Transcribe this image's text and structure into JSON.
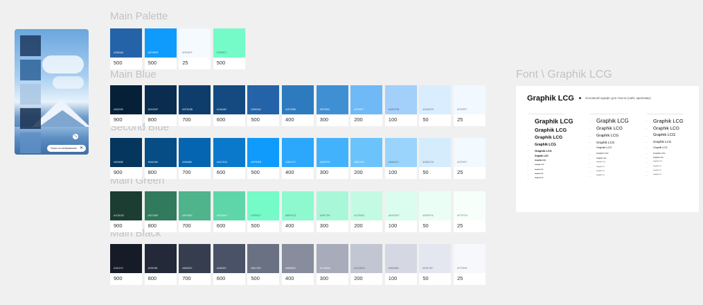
{
  "preview": {
    "tones": [
      "#1E3A5F",
      "#2F6399",
      "#A9C6E3",
      "#1B3354",
      "#5F8FC4"
    ],
    "chip_label": "Поиск по изображению",
    "chip_close": "✕",
    "cursor_icon": "expand-icon"
  },
  "sections": {
    "main_palette": "Main Palette",
    "main_blue": "Main Blue",
    "second_blue": "Second Blue",
    "main_green": "Main Green",
    "main_black": "Main Black",
    "font": "Font \\ Graphik LCG"
  },
  "palettes": {
    "main_palette": [
      {
        "color": "#2563A8",
        "shade": "500"
      },
      {
        "color": "#0F9BFB",
        "shade": "500"
      },
      {
        "color": "#F5FAFF",
        "shade": "25"
      },
      {
        "color": "#75FBC7",
        "shade": "500"
      }
    ],
    "main_blue": [
      {
        "color": "#062038",
        "shade": "900"
      },
      {
        "color": "#0A2D4F",
        "shade": "800"
      },
      {
        "color": "#0F3D6B",
        "shade": "700"
      },
      {
        "color": "#154A80",
        "shade": "600"
      },
      {
        "color": "#2563A8",
        "shade": "500"
      },
      {
        "color": "#2D7BBE",
        "shade": "400"
      },
      {
        "color": "#3F90D3",
        "shade": "300"
      },
      {
        "color": "#6FB9F7",
        "shade": "200"
      },
      {
        "color": "#A3CFFB",
        "shade": "100"
      },
      {
        "color": "#DAEDFE",
        "shade": "50"
      },
      {
        "color": "#F2F8FF",
        "shade": "25"
      }
    ],
    "second_blue": [
      {
        "color": "#05365E",
        "shade": "900"
      },
      {
        "color": "#064D85",
        "shade": "800"
      },
      {
        "color": "#0665B0",
        "shade": "700"
      },
      {
        "color": "#0A79CB",
        "shade": "600"
      },
      {
        "color": "#0F9BFB",
        "shade": "500"
      },
      {
        "color": "#2BA7FC",
        "shade": "400"
      },
      {
        "color": "#43B2FD",
        "shade": "300"
      },
      {
        "color": "#6BC3FC",
        "shade": "200"
      },
      {
        "color": "#9AD4FC",
        "shade": "100"
      },
      {
        "color": "#D5ECFD",
        "shade": "50"
      },
      {
        "color": "#F2F9FF",
        "shade": "25"
      }
    ],
    "main_green": [
      {
        "color": "#1C3D32",
        "shade": "900"
      },
      {
        "color": "#317A5D",
        "shade": "800"
      },
      {
        "color": "#4FB38C",
        "shade": "700"
      },
      {
        "color": "#5FD6A9",
        "shade": "600"
      },
      {
        "color": "#75FBC7",
        "shade": "500"
      },
      {
        "color": "#8EF9CE",
        "shade": "400"
      },
      {
        "color": "#A8F7D9",
        "shade": "300"
      },
      {
        "color": "#C2FAE4",
        "shade": "200"
      },
      {
        "color": "#DAFDEF",
        "shade": "100"
      },
      {
        "color": "#EBFEF6",
        "shade": "50"
      },
      {
        "color": "#F7FFFB",
        "shade": "25"
      }
    ],
    "main_black": [
      {
        "color": "#161C27",
        "shade": "900"
      },
      {
        "color": "#232938",
        "shade": "800"
      },
      {
        "color": "#363D4F",
        "shade": "700"
      },
      {
        "color": "#4A5267",
        "shade": "600"
      },
      {
        "color": "#6A7183",
        "shade": "500"
      },
      {
        "color": "#888D9D",
        "shade": "400"
      },
      {
        "color": "#A7ABBA",
        "shade": "300"
      },
      {
        "color": "#C2C6D3",
        "shade": "200"
      },
      {
        "color": "#D5D8E2",
        "shade": "100"
      },
      {
        "color": "#E4E7EF",
        "shade": "50"
      },
      {
        "color": "#F7F8FB",
        "shade": "25"
      }
    ]
  },
  "font_card": {
    "title": "Graphik LCG",
    "subtitle": "Основной шрифт для текста (сайт, креативы)",
    "sample": "Graphik LCG"
  }
}
